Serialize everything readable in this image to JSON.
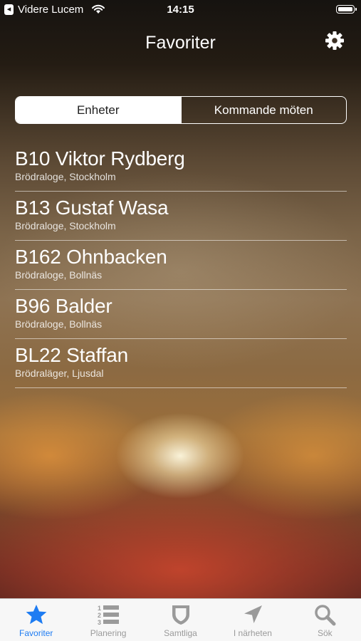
{
  "status_bar": {
    "back_glyph": "◂",
    "carrier": "Videre Lucem",
    "time": "14:15",
    "wifi_icon": "wifi-icon",
    "battery_icon": "battery-icon"
  },
  "nav": {
    "title": "Favoriter",
    "settings_icon": "gear-icon"
  },
  "segments": {
    "items": [
      "Enheter",
      "Kommande möten"
    ],
    "selected": "Enheter"
  },
  "favorites": [
    {
      "name": "B10 Viktor Rydberg",
      "detail": "Brödraloge, Stockholm"
    },
    {
      "name": "B13 Gustaf Wasa",
      "detail": "Brödraloge, Stockholm"
    },
    {
      "name": "B162 Ohnbacken",
      "detail": "Brödraloge, Bollnäs"
    },
    {
      "name": "B96 Balder",
      "detail": "Brödraloge, Bollnäs"
    },
    {
      "name": "BL22 Staffan",
      "detail": "Brödraläger, Ljusdal"
    }
  ],
  "tabbar": {
    "items": [
      {
        "label": "Favoriter",
        "icon": "star-icon"
      },
      {
        "label": "Planering",
        "icon": "numbered-list-icon"
      },
      {
        "label": "Samtliga",
        "icon": "shield-icon"
      },
      {
        "label": "I närheten",
        "icon": "location-arrow-icon"
      },
      {
        "label": "Sök",
        "icon": "search-icon"
      }
    ],
    "selected": "Favoriter"
  },
  "colors": {
    "accent": "#1e7cf2",
    "tab_inactive": "#9a9a9a",
    "tabbar_bg": "#f7f7f7"
  }
}
